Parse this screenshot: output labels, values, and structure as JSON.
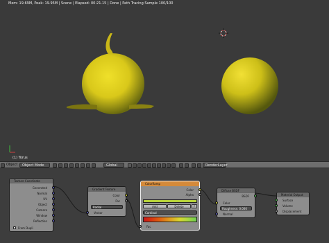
{
  "viewport": {
    "status": "Mem: 19.69M, Peak: 19.95M | Scene | Elapsed: 00:21.15 | Done | Path Tracing Sample 100/100",
    "object_label": "(1) Torus"
  },
  "header": {
    "view": "Object",
    "mode": "Object Mode",
    "orientation": "Global",
    "layer": "RenderLayer"
  },
  "nodes": {
    "texcoord": {
      "title": "Texture Coordinate",
      "outputs": [
        "Generated",
        "Normal",
        "UV",
        "Object",
        "Camera",
        "Window",
        "Reflection"
      ],
      "option": "From Dupli"
    },
    "gradient": {
      "title": "Gradient Texture",
      "outputs": [
        "Color",
        "Fac"
      ],
      "type": "Radial",
      "input": "Vector"
    },
    "colorramp": {
      "title": "ColorRamp",
      "outputs": [
        "Color",
        "Alpha"
      ],
      "add": "Add",
      "delete": "Delete",
      "flip": "F",
      "interpolation": "Cardinal",
      "input": "Fac"
    },
    "diffuse": {
      "title": "Diffuse BSDF",
      "output": "BSDF",
      "inputs": [
        "Color",
        "Roughness: 0.000",
        "Normal"
      ]
    },
    "output": {
      "title": "Material Output",
      "inputs": [
        "Surface",
        "Volume",
        "Displacement"
      ]
    }
  },
  "colors": {
    "viewport_bg": "#3a3a3a",
    "sphere_yellow": "#e6d21a",
    "sphere_shadow": "#6a6a10",
    "socket_yellow": "#e6e63a",
    "socket_purple": "#6464c8",
    "socket_gray": "#a0a0a0",
    "socket_green": "#5ad05a",
    "node_selected": "#d48a3a"
  }
}
